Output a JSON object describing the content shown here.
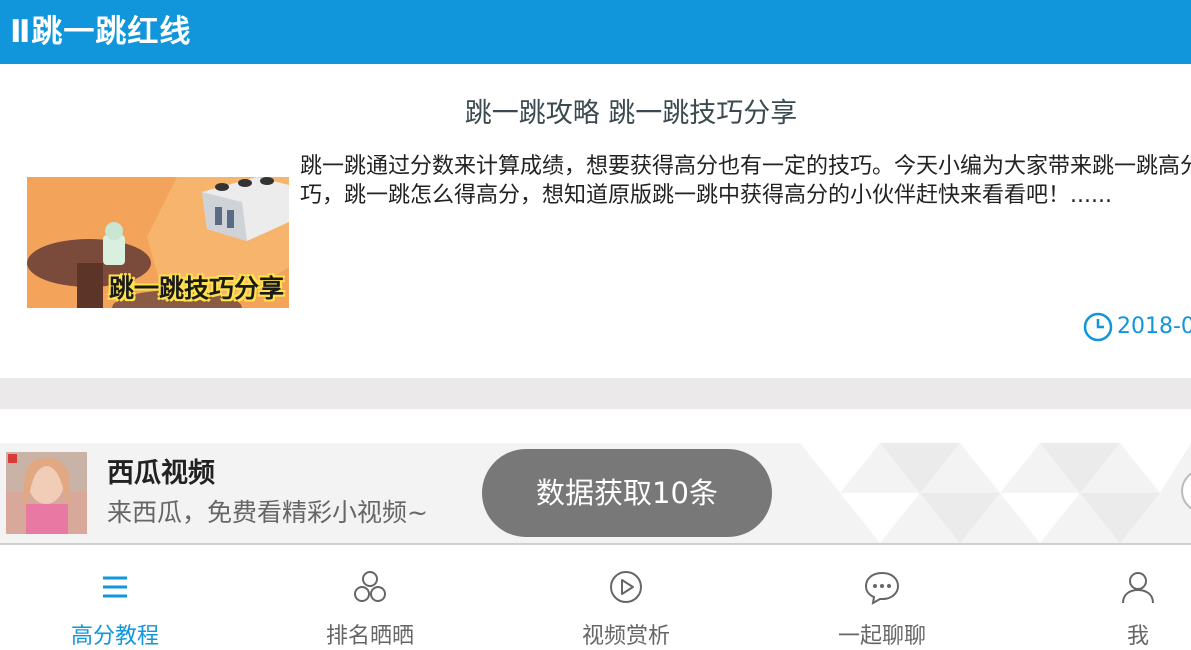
{
  "header": {
    "title": "Ⅱ跳一跳红线"
  },
  "article": {
    "title": "跳一跳攻略 跳一跳技巧分享",
    "summary": "跳一跳通过分数来计算成绩，想要获得高分也有一定的技巧。今天小编为大家带来跳一跳高分技巧，跳一跳怎么得高分，想知道原版跳一跳中获得高分的小伙伴赶快来看看吧！......",
    "thumbnail_caption": "跳一跳技巧分享",
    "date": "2018-0"
  },
  "ad": {
    "name": "西瓜视频",
    "description": "来西瓜，免费看精彩小视频~"
  },
  "toast": {
    "message": "数据获取10条"
  },
  "bottom_nav": [
    {
      "label": "高分教程",
      "icon": "menu-icon",
      "active": true
    },
    {
      "label": "排名晒晒",
      "icon": "circles-icon",
      "active": false
    },
    {
      "label": "视频赏析",
      "icon": "play-circle-icon",
      "active": false
    },
    {
      "label": "一起聊聊",
      "icon": "chat-icon",
      "active": false
    },
    {
      "label": "我",
      "icon": "user-icon",
      "active": false
    }
  ],
  "colors": {
    "accent": "#1296db",
    "separator": "#ece9ea",
    "toast": "#6e6e6e"
  }
}
